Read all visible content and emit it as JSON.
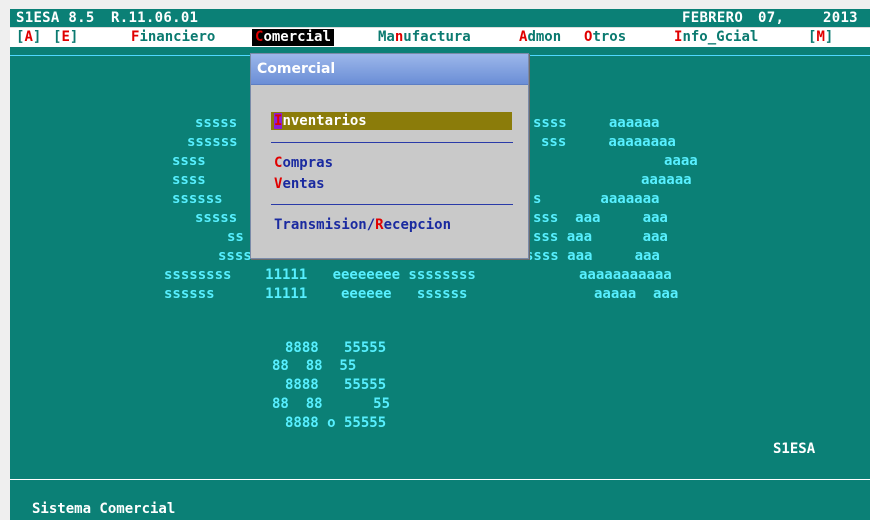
{
  "titlebar": {
    "app": "S1ESA 8.5",
    "version": "R.11.06.01",
    "month": "FEBRERO",
    "day": "07,",
    "year": "2013"
  },
  "menubar": {
    "items": [
      {
        "pre": "[",
        "hk": "A",
        "post": "]"
      },
      {
        "pre": "[",
        "hk": "E",
        "post": "]"
      },
      {
        "pre": "",
        "hk": "F",
        "post": "inanciero"
      },
      {
        "pre": "",
        "hk": "C",
        "post": "omercial"
      },
      {
        "pre": "Ma",
        "hk": "n",
        "post": "ufactura"
      },
      {
        "pre": "",
        "hk": "A",
        "post": "dmon"
      },
      {
        "pre": "",
        "hk": "O",
        "post": "tros"
      },
      {
        "pre": "",
        "hk": "I",
        "post": "nfo_Gcial"
      },
      {
        "pre": "[",
        "hk": "M",
        "post": "]"
      }
    ]
  },
  "dropdown": {
    "title": "Comercial",
    "items": [
      {
        "pre": "",
        "hk": "I",
        "post": "nventarios"
      },
      {
        "pre": "",
        "hk": "C",
        "post": "ompras"
      },
      {
        "pre": "",
        "hk": "V",
        "post": "entas"
      },
      {
        "pre": "Transmision/",
        "hk": "R",
        "post": "ecepcion"
      }
    ]
  },
  "art": {
    "lines": [
      "sssss",
      "ssssss",
      "ssss",
      "ssss",
      "ssssss",
      "sssss",
      "ss",
      "ssss   11111 eee",
      "ssssssss    11111   eeeeeeee ssssssss",
      "ssssss      11111    eeeeee   ssssss",
      "ssss     aaaaaa",
      "sss     aaaaaaaa",
      "aaaa",
      "aaaaaa",
      "s       aaaaaaa",
      "sss  aaa     aaa",
      "sss aaa      aaa",
      "ssss aaa     aaa",
      "aaaaaaaaaaa",
      "aaaaa  aaa",
      "8888   55555",
      "88  88  55",
      "8888   55555",
      "88  88      55",
      "8888 o 55555"
    ]
  },
  "watermark": "S1ESA",
  "status": "Sistema Comercial"
}
